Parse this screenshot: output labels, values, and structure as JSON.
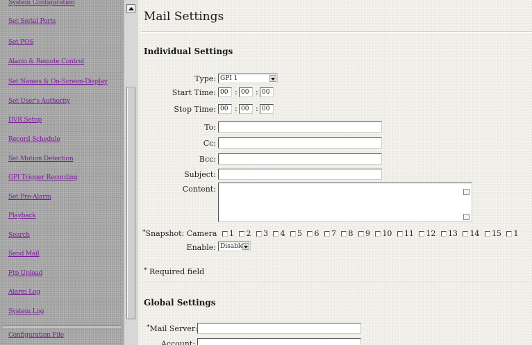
{
  "sidebar": {
    "items": [
      {
        "label": "System Configuration"
      },
      {
        "label": "Set Serial Ports"
      },
      {
        "label": "Set POS"
      },
      {
        "label": "Alarm & Remote Control"
      },
      {
        "label": "Set Names & On-Screen-Display"
      },
      {
        "label": "Set User's Authority"
      },
      {
        "label": "DVR Setup"
      },
      {
        "label": "Record Schedule"
      },
      {
        "label": "Set Motion Detection"
      },
      {
        "label": "GPI Trigger Recording"
      },
      {
        "label": "Set Pre-Alarm"
      },
      {
        "label": "Playback"
      },
      {
        "label": "Search"
      },
      {
        "label": "Send Mail"
      },
      {
        "label": "Ftp Upload"
      },
      {
        "label": "Alarm Log"
      },
      {
        "label": "System Log"
      },
      {
        "label": "Configuration File"
      }
    ]
  },
  "main": {
    "title": "Mail Settings",
    "individual": {
      "heading": "Individual Settings",
      "type_label": "Type:",
      "type_value": "GPI 1",
      "start_label": "Start Time:",
      "start_h": "00",
      "start_m": "00",
      "start_s": "00",
      "stop_label": "Stop Time:",
      "stop_h": "00",
      "stop_m": "00",
      "stop_s": "00",
      "time_sep": ":",
      "to_label": "To:",
      "to_value": "",
      "cc_label": "Cc:",
      "cc_value": "",
      "bcc_label": "Bcc:",
      "bcc_value": "",
      "subject_label": "Subject:",
      "subject_value": "",
      "content_label": "Content:",
      "content_value": "",
      "required_mark": "*",
      "snapshot_label": "Snapshot:",
      "camera_label": "Camera",
      "cameras": [
        "1",
        "2",
        "3",
        "4",
        "5",
        "6",
        "7",
        "8",
        "9",
        "10",
        "11",
        "12",
        "13",
        "14",
        "15",
        "1"
      ],
      "enable_label": "Enable:",
      "enable_value": "Disable",
      "required_note": "Required field"
    },
    "global": {
      "heading": "Global Settings",
      "mail_server_label": "Mail Server:",
      "mail_server_value": "",
      "account_label": "Account:",
      "account_value": ""
    }
  }
}
